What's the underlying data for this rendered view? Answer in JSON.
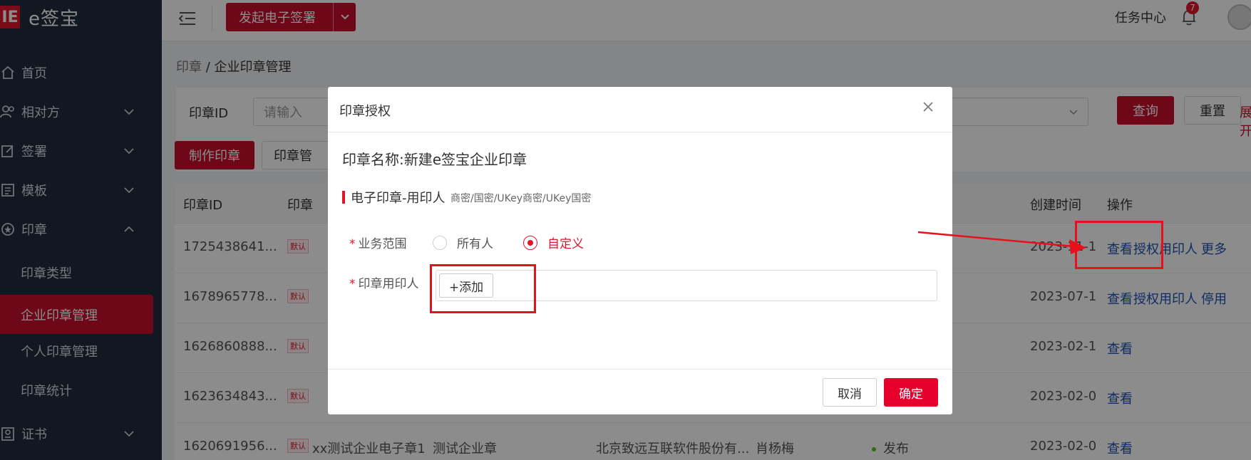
{
  "app": {
    "logo_mark": "IE",
    "logo_text": "e签宝"
  },
  "sidebar": {
    "items": [
      {
        "label": "首页",
        "icon": "home-icon"
      },
      {
        "label": "相对方",
        "icon": "users-icon"
      },
      {
        "label": "签署",
        "icon": "sign-icon"
      },
      {
        "label": "模板",
        "icon": "template-icon"
      },
      {
        "label": "印章",
        "icon": "seal-icon"
      }
    ],
    "sub_items": [
      {
        "label": "印章类型"
      },
      {
        "label": "企业印章管理",
        "active": true
      },
      {
        "label": "个人印章管理"
      },
      {
        "label": "印章统计"
      }
    ],
    "bottom_item": {
      "label": "证书",
      "icon": "certificate-icon"
    }
  },
  "header": {
    "start_button": "发起电子签署",
    "task_center": "任务中心",
    "badge_count": "7"
  },
  "breadcrumb": {
    "parent": "印章",
    "separator": " / ",
    "current": "企业印章管理"
  },
  "search": {
    "label": "印章ID",
    "placeholder": "请输入",
    "query_button": "查询",
    "reset_button": "重置",
    "expand_link": "展开"
  },
  "toolbar": {
    "make_button": "制作印章",
    "manage_button": "印章管"
  },
  "table": {
    "headers": [
      "印章ID",
      "印章",
      "创建时间",
      "操作"
    ],
    "rows": [
      {
        "id": "1725438641...",
        "tag": "默认",
        "date": "2023-11-1",
        "ops": [
          "查看",
          "授权用印人",
          "更多"
        ]
      },
      {
        "id": "1678965778...",
        "tag": "默认",
        "date": "2023-07-1",
        "ops": [
          "查看",
          "授权用印人",
          "停用"
        ]
      },
      {
        "id": "1626860888...",
        "tag": "默认",
        "date": "2023-02-1",
        "ops": [
          "查看"
        ]
      },
      {
        "id": "1623634843...",
        "tag": "默认",
        "date": "2023-02-0",
        "ops": [
          "查看"
        ]
      },
      {
        "id": "1620691956...",
        "tag": "默认",
        "name": "xx测试企业电子章1",
        "type": "测试企业章",
        "company": "北京致远互联软件股份有...",
        "creator": "肖杨梅",
        "status": "发布",
        "date": "2023-02-0",
        "ops": [
          "查看"
        ]
      }
    ]
  },
  "modal": {
    "title": "印章授权",
    "seal_name": "印章名称:新建e签宝企业印章",
    "section_title": "电子印章-用印人",
    "section_subtitle": "商密/国密/UKey商密/UKey国密",
    "scope_label": "业务范围",
    "scope_options": [
      "所有人",
      "自定义"
    ],
    "scope_selected": "自定义",
    "user_label": "印章用印人",
    "add_button": "+添加",
    "cancel_button": "取消",
    "ok_button": "确定"
  },
  "colors": {
    "brand": "#c8102e",
    "sidebar_bg": "#1f2d3d",
    "link": "#1e50b4",
    "annotation": "#e8101c"
  }
}
